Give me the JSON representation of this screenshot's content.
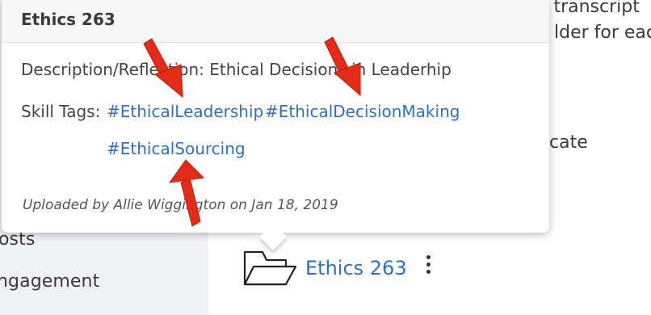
{
  "background": {
    "line1": "s, transcript",
    "line2": "lder for eac",
    "line3": "cate"
  },
  "sidebar": {
    "items": [
      {
        "label": "osts"
      },
      {
        "label": "ngagement"
      }
    ]
  },
  "file": {
    "name": "Ethics 263",
    "icon": "folder-icon",
    "menu_icon": "kebab-menu-icon"
  },
  "popover": {
    "title": "Ethics 263",
    "description": "Description/Reflection: Ethical Decisions in Leaderhip",
    "skill_tags_label": "Skill Tags:",
    "tags": [
      "#EthicalLeadership",
      "#EthicalDecisionMaking",
      "#EthicalSourcing"
    ],
    "uploaded": "Uploaded by Allie Wiggington on Jan 18, 2019"
  },
  "colors": {
    "link": "#2f6fcb",
    "arrow": "#e32b17",
    "sidebar_bg": "#f0f1f4"
  }
}
